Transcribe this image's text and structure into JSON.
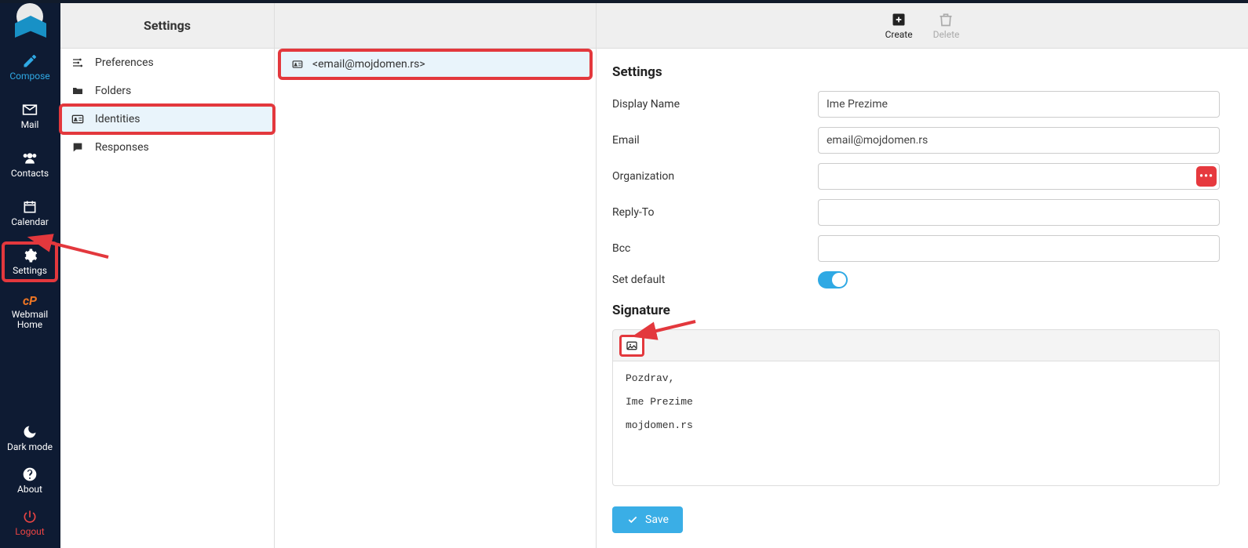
{
  "rail": {
    "items": [
      {
        "label": "Compose",
        "key": "compose"
      },
      {
        "label": "Mail",
        "key": "mail"
      },
      {
        "label": "Contacts",
        "key": "contacts"
      },
      {
        "label": "Calendar",
        "key": "calendar"
      },
      {
        "label": "Settings",
        "key": "settings"
      },
      {
        "label": "Webmail Home",
        "key": "webmail-home"
      }
    ],
    "bottom": [
      {
        "label": "Dark mode",
        "key": "dark-mode"
      },
      {
        "label": "About",
        "key": "about"
      },
      {
        "label": "Logout",
        "key": "logout"
      }
    ]
  },
  "col1": {
    "title": "Settings",
    "items": [
      {
        "label": "Preferences"
      },
      {
        "label": "Folders"
      },
      {
        "label": "Identities"
      },
      {
        "label": "Responses"
      }
    ]
  },
  "col2": {
    "identity_label": "<email@mojdomen.rs>"
  },
  "toolbar": {
    "create_label": "Create",
    "delete_label": "Delete"
  },
  "form": {
    "section_title": "Settings",
    "rows": {
      "display_name": {
        "label": "Display Name",
        "value": "Ime Prezime"
      },
      "email": {
        "label": "Email",
        "value": "email@mojdomen.rs"
      },
      "organization": {
        "label": "Organization",
        "value": ""
      },
      "reply_to": {
        "label": "Reply-To",
        "value": ""
      },
      "bcc": {
        "label": "Bcc",
        "value": ""
      },
      "set_default": {
        "label": "Set default",
        "value": true
      }
    },
    "signature": {
      "title": "Signature",
      "text": "Pozdrav,\n\nIme Prezime\n\nmojdomen.rs"
    },
    "save_label": "Save",
    "org_more_glyph": "•••"
  }
}
